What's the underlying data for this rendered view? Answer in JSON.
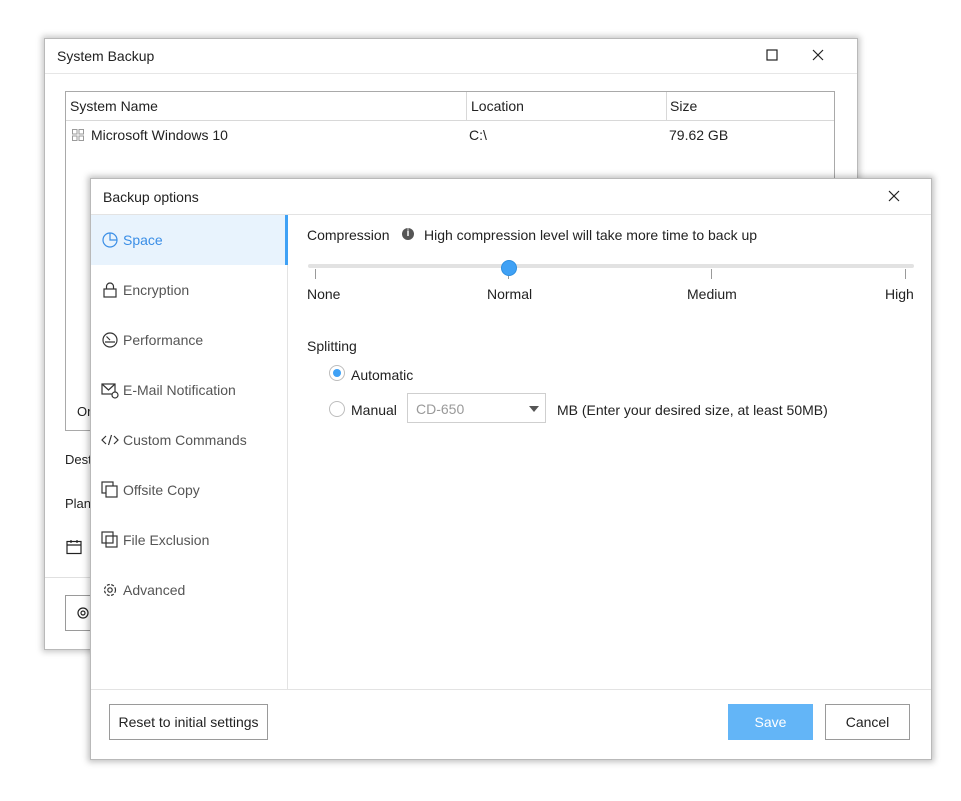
{
  "back_window": {
    "title": "System Backup",
    "table": {
      "headers": [
        "System Name",
        "Location",
        "Size"
      ],
      "rows": [
        {
          "name": "Microsoft Windows 10",
          "location": "C:\\",
          "size": "79.62 GB"
        }
      ]
    },
    "peek_labels": {
      "row_partial": "Or",
      "destination_partial": "Dest",
      "plan_partial": "Plan"
    }
  },
  "dialog": {
    "title": "Backup options",
    "nav": [
      {
        "label": "Space",
        "icon": "pie-chart-icon",
        "active": true
      },
      {
        "label": "Encryption",
        "icon": "lock-icon",
        "active": false
      },
      {
        "label": "Performance",
        "icon": "gauge-icon",
        "active": false
      },
      {
        "label": "E-Mail Notification",
        "icon": "mail-settings-icon",
        "active": false
      },
      {
        "label": "Custom Commands",
        "icon": "code-icon",
        "active": false
      },
      {
        "label": "Offsite Copy",
        "icon": "copy-icon",
        "active": false
      },
      {
        "label": "File Exclusion",
        "icon": "file-exclusion-icon",
        "active": false
      },
      {
        "label": "Advanced",
        "icon": "gear-icon",
        "active": false
      }
    ],
    "compression": {
      "label": "Compression",
      "info": "High compression level will take more time to back up",
      "levels": [
        "None",
        "Normal",
        "Medium",
        "High"
      ],
      "selected": "Normal"
    },
    "splitting": {
      "label": "Splitting",
      "options": [
        "Automatic",
        "Manual"
      ],
      "selected": "Automatic",
      "manual_size": "CD-650",
      "manual_hint": "MB (Enter your desired size, at least 50MB)"
    },
    "buttons": {
      "reset": "Reset to initial settings",
      "save": "Save",
      "cancel": "Cancel"
    }
  },
  "colors": {
    "accent": "#3fa1f5",
    "save_button": "#63b5f7",
    "active_nav_bg": "#e8f3fd"
  }
}
